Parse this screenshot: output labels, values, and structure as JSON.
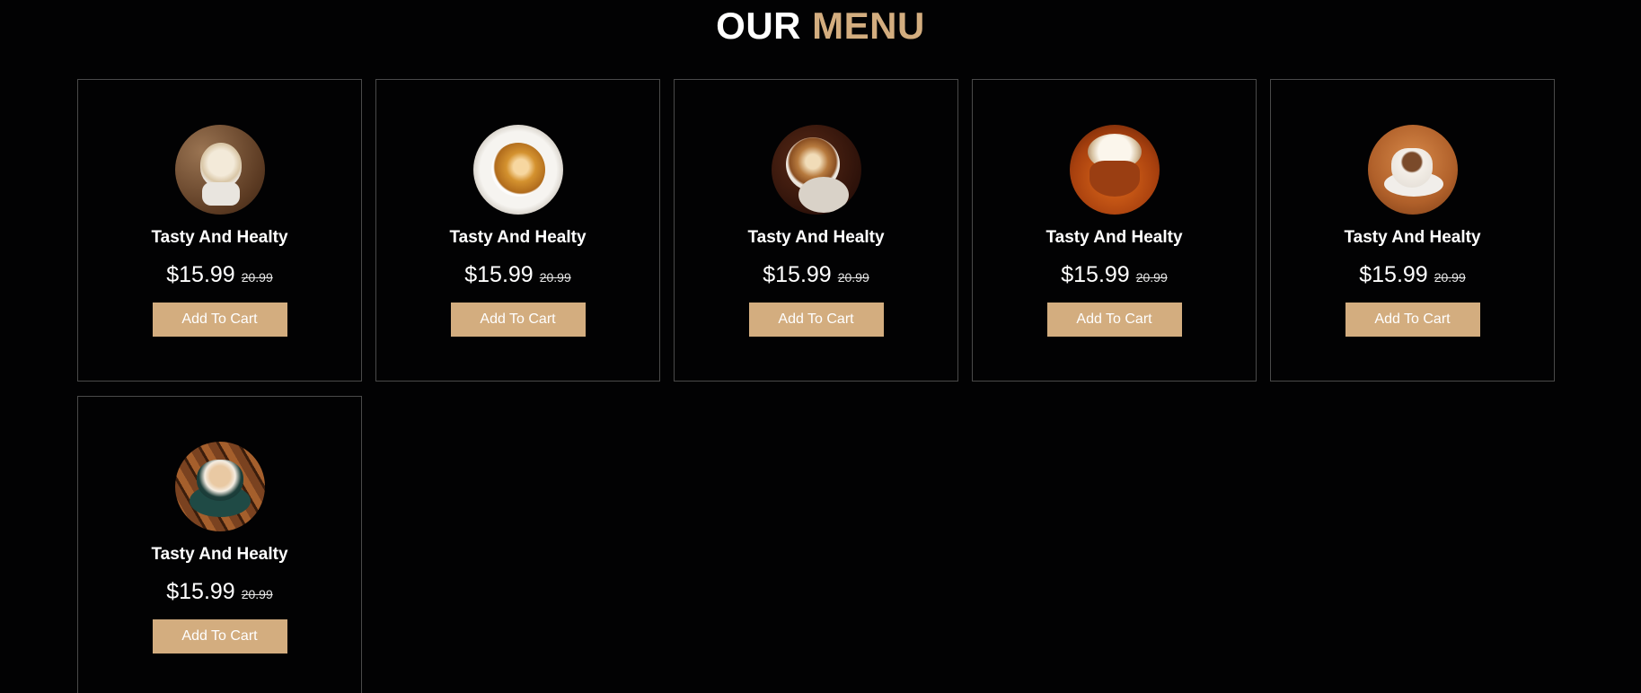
{
  "heading": {
    "part1": "OUR",
    "part2": "MENU"
  },
  "colors": {
    "accent": "#d3ad7f",
    "background": "#020203",
    "border": "#4a4a4a"
  },
  "items": [
    {
      "name": "Tasty And Healty",
      "price": "$15.99",
      "old_price": "20.99",
      "button": "Add To Cart",
      "icon": "coffee-cup-image"
    },
    {
      "name": "Tasty And Healty",
      "price": "$15.99",
      "old_price": "20.99",
      "button": "Add To Cart",
      "icon": "coffee-cup-image"
    },
    {
      "name": "Tasty And Healty",
      "price": "$15.99",
      "old_price": "20.99",
      "button": "Add To Cart",
      "icon": "coffee-cup-image"
    },
    {
      "name": "Tasty And Healty",
      "price": "$15.99",
      "old_price": "20.99",
      "button": "Add To Cart",
      "icon": "coffee-cup-image"
    },
    {
      "name": "Tasty And Healty",
      "price": "$15.99",
      "old_price": "20.99",
      "button": "Add To Cart",
      "icon": "coffee-cup-image"
    },
    {
      "name": "Tasty And Healty",
      "price": "$15.99",
      "old_price": "20.99",
      "button": "Add To Cart",
      "icon": "coffee-cup-image"
    }
  ]
}
